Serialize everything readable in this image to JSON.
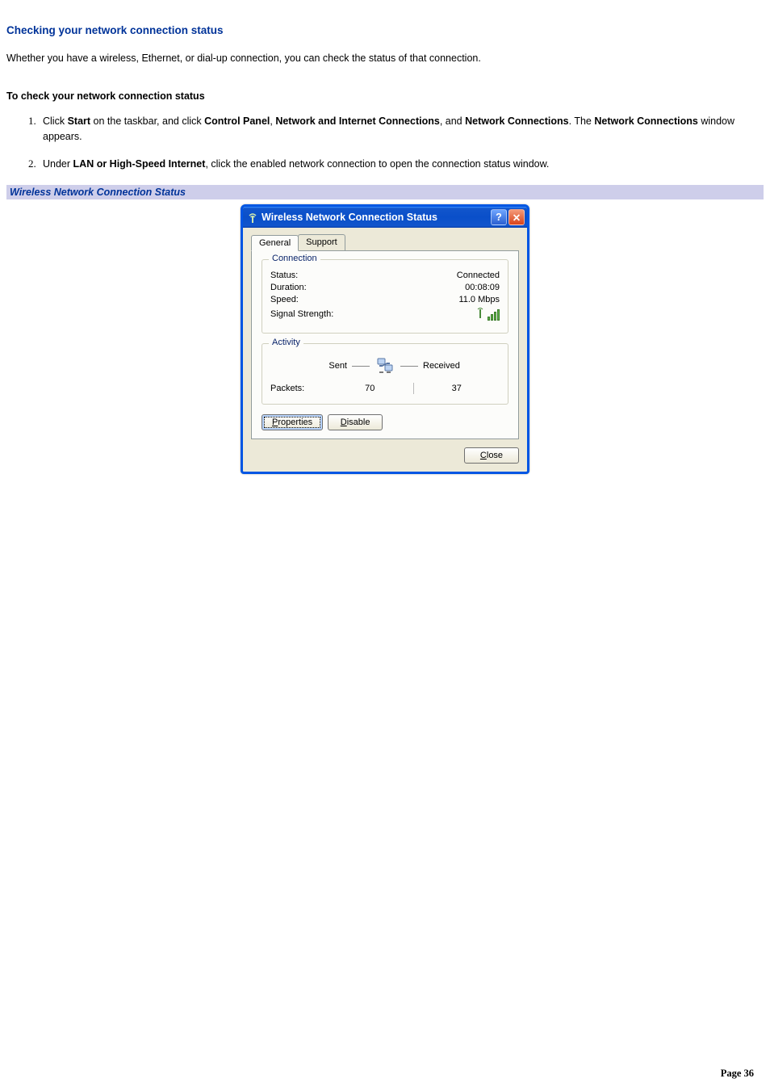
{
  "heading": "Checking your network connection status",
  "intro": "Whether you have a wireless, Ethernet, or dial-up connection, you can check the status of that connection.",
  "subheading": "To check your network connection status",
  "steps": {
    "s1": {
      "pre": "Click ",
      "b1": "Start",
      "t1": " on the taskbar, and click ",
      "b2": "Control Panel",
      "t2": ", ",
      "b3": "Network and Internet Connections",
      "t3": ", and ",
      "b4": "Network Connections",
      "t4": ". The ",
      "b5": "Network Connections",
      "t5": " window appears."
    },
    "s2": {
      "pre": "Under ",
      "b1": "LAN or High-Speed Internet",
      "t1": ", click the enabled network connection to open the connection status window."
    }
  },
  "caption": "Wireless Network Connection Status",
  "dialog": {
    "title": "Wireless Network Connection Status",
    "help_glyph": "?",
    "close_glyph": "✕",
    "tabs": {
      "general": "General",
      "support": "Support"
    },
    "connection": {
      "legend": "Connection",
      "status_label": "Status:",
      "status_value": "Connected",
      "duration_label": "Duration:",
      "duration_value": "00:08:09",
      "speed_label": "Speed:",
      "speed_value": "11.0 Mbps",
      "signal_label": "Signal Strength:"
    },
    "activity": {
      "legend": "Activity",
      "sent": "Sent",
      "received": "Received",
      "packets_label": "Packets:",
      "packets_sent": "70",
      "packets_received": "37"
    },
    "buttons": {
      "properties": "Properties",
      "disable": "Disable",
      "close": "Close"
    }
  },
  "page_label": "Page ",
  "page_number": "36"
}
